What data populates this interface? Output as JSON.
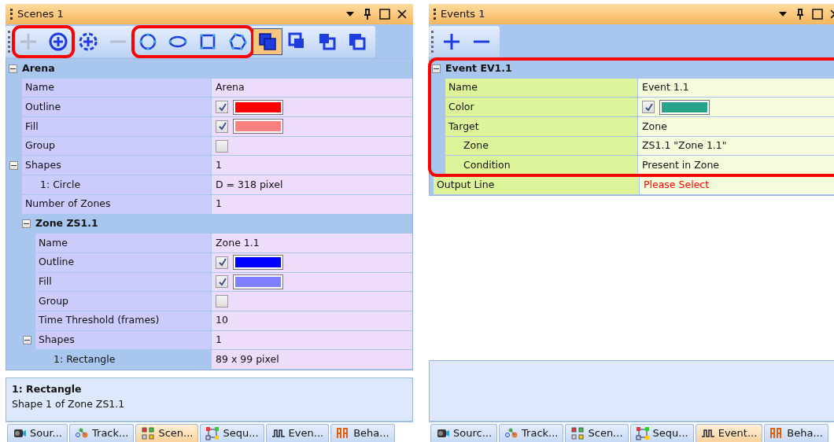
{
  "panels": [
    {
      "title": "Scenes 1",
      "toolbar": [
        {
          "highlighted": true,
          "buttons": [
            {
              "kind": "plus",
              "disabled": true,
              "selected": false
            },
            {
              "kind": "circle-plus",
              "disabled": false,
              "selected": false
            }
          ]
        },
        {
          "highlighted": false,
          "buttons": [
            {
              "kind": "target-plus",
              "disabled": false,
              "selected": false
            },
            {
              "kind": "minus",
              "disabled": true,
              "selected": false
            }
          ]
        },
        {
          "highlighted": true,
          "buttons": [
            {
              "kind": "circle",
              "disabled": false,
              "selected": false
            },
            {
              "kind": "ellipse",
              "disabled": false,
              "selected": false
            },
            {
              "kind": "square",
              "disabled": false,
              "selected": false
            },
            {
              "kind": "polygon",
              "disabled": false,
              "selected": false
            }
          ]
        },
        {
          "highlighted": false,
          "buttons": [
            {
              "kind": "stack-front",
              "disabled": false,
              "selected": true
            },
            {
              "kind": "stack-forward",
              "disabled": false,
              "selected": false
            },
            {
              "kind": "stack-backward",
              "disabled": false,
              "selected": false
            },
            {
              "kind": "stack-back",
              "disabled": false,
              "selected": false
            }
          ]
        }
      ],
      "grid": [
        {
          "kind": "category",
          "label": "Arena",
          "expanded": true,
          "highlighted": false,
          "children": [
            {
              "kind": "text",
              "label": "Name",
              "value": "Arena"
            },
            {
              "kind": "color",
              "label": "Outline",
              "checked": true,
              "color": "#ff0000"
            },
            {
              "kind": "color",
              "label": "Fill",
              "checked": true,
              "color": "#ff8080"
            },
            {
              "kind": "check",
              "label": "Group",
              "checked": false
            },
            {
              "kind": "text",
              "label": "Shapes",
              "value": "1",
              "expanded": true,
              "children": [
                {
                  "kind": "text",
                  "label": "1: Circle",
                  "value": "D = 318 pixel",
                  "selected": false
                }
              ]
            },
            {
              "kind": "text",
              "label": "Number of Zones",
              "value": "1"
            },
            {
              "kind": "category",
              "label": "Zone ZS1.1",
              "expanded": true,
              "highlighted": false,
              "children": [
                {
                  "kind": "text",
                  "label": "Name",
                  "value": "Zone 1.1"
                },
                {
                  "kind": "color",
                  "label": "Outline",
                  "checked": true,
                  "color": "#0000ff"
                },
                {
                  "kind": "color",
                  "label": "Fill",
                  "checked": true,
                  "color": "#8080ff"
                },
                {
                  "kind": "check",
                  "label": "Group",
                  "checked": false
                },
                {
                  "kind": "text",
                  "label": "Time Threshold (frames)",
                  "value": "10"
                },
                {
                  "kind": "text",
                  "label": "Shapes",
                  "value": "1",
                  "expanded": true,
                  "children": [
                    {
                      "kind": "text",
                      "label": "1: Rectangle",
                      "value": "89 x 99 pixel",
                      "selected": true
                    }
                  ]
                }
              ]
            }
          ]
        }
      ],
      "description": {
        "title": "1: Rectangle",
        "text": "Shape 1 of Zone ZS1.1"
      },
      "tabs": [
        {
          "label": "Sour...",
          "selected": false
        },
        {
          "label": "Track...",
          "selected": false
        },
        {
          "label": "Scen...",
          "selected": true
        },
        {
          "label": "Sequ...",
          "selected": false
        },
        {
          "label": "Even...",
          "selected": false
        },
        {
          "label": "Beha...",
          "selected": false
        }
      ]
    },
    {
      "title": "Events 1",
      "toolbar": [
        {
          "highlighted": false,
          "buttons": [
            {
              "kind": "plus",
              "disabled": false,
              "selected": false
            },
            {
              "kind": "minus",
              "disabled": false,
              "selected": false
            }
          ]
        }
      ],
      "grid": [
        {
          "kind": "category",
          "label": "Event EV1.1",
          "expanded": true,
          "highlighted": true,
          "children": [
            {
              "kind": "text",
              "label": "Name",
              "value": "Event 1.1"
            },
            {
              "kind": "color",
              "label": "Color",
              "checked": true,
              "color": "#26a38a"
            },
            {
              "kind": "text",
              "label": "Target",
              "value": "Zone",
              "children": [
                {
                  "kind": "text",
                  "label": "Zone",
                  "value": "ZS1.1 \"Zone 1.1\""
                },
                {
                  "kind": "text",
                  "label": "Condition",
                  "value": "Present in Zone"
                }
              ]
            }
          ]
        },
        {
          "kind": "warning",
          "label": "Output Line",
          "value": "Please Select"
        }
      ],
      "tabs": [
        {
          "label": "Sourc...",
          "selected": false
        },
        {
          "label": "Track...",
          "selected": false
        },
        {
          "label": "Scen...",
          "selected": false
        },
        {
          "label": "Sequ...",
          "selected": false
        },
        {
          "label": "Event...",
          "selected": true
        },
        {
          "label": "Beha...",
          "selected": false
        }
      ]
    }
  ]
}
